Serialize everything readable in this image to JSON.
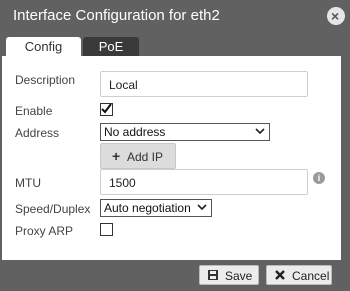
{
  "dialog": {
    "title": "Interface Configuration for eth2",
    "close_icon": "close-icon"
  },
  "tabs": [
    {
      "label": "Config",
      "active": true
    },
    {
      "label": "PoE",
      "active": false
    }
  ],
  "form": {
    "description_label": "Description",
    "description_value": "Local",
    "enable_label": "Enable",
    "enable_checked": true,
    "address_label": "Address",
    "address_value": "No address",
    "add_ip_label": "Add IP",
    "mtu_label": "MTU",
    "mtu_value": "1500",
    "speed_label": "Speed/Duplex",
    "speed_value": "Auto negotiation",
    "proxy_arp_label": "Proxy ARP",
    "proxy_arp_checked": false
  },
  "footer": {
    "save_label": "Save",
    "cancel_label": "Cancel"
  },
  "colors": {
    "titlebar": "#616161",
    "active_tab": "#ffffff",
    "inactive_tab": "#3a3a3a"
  }
}
